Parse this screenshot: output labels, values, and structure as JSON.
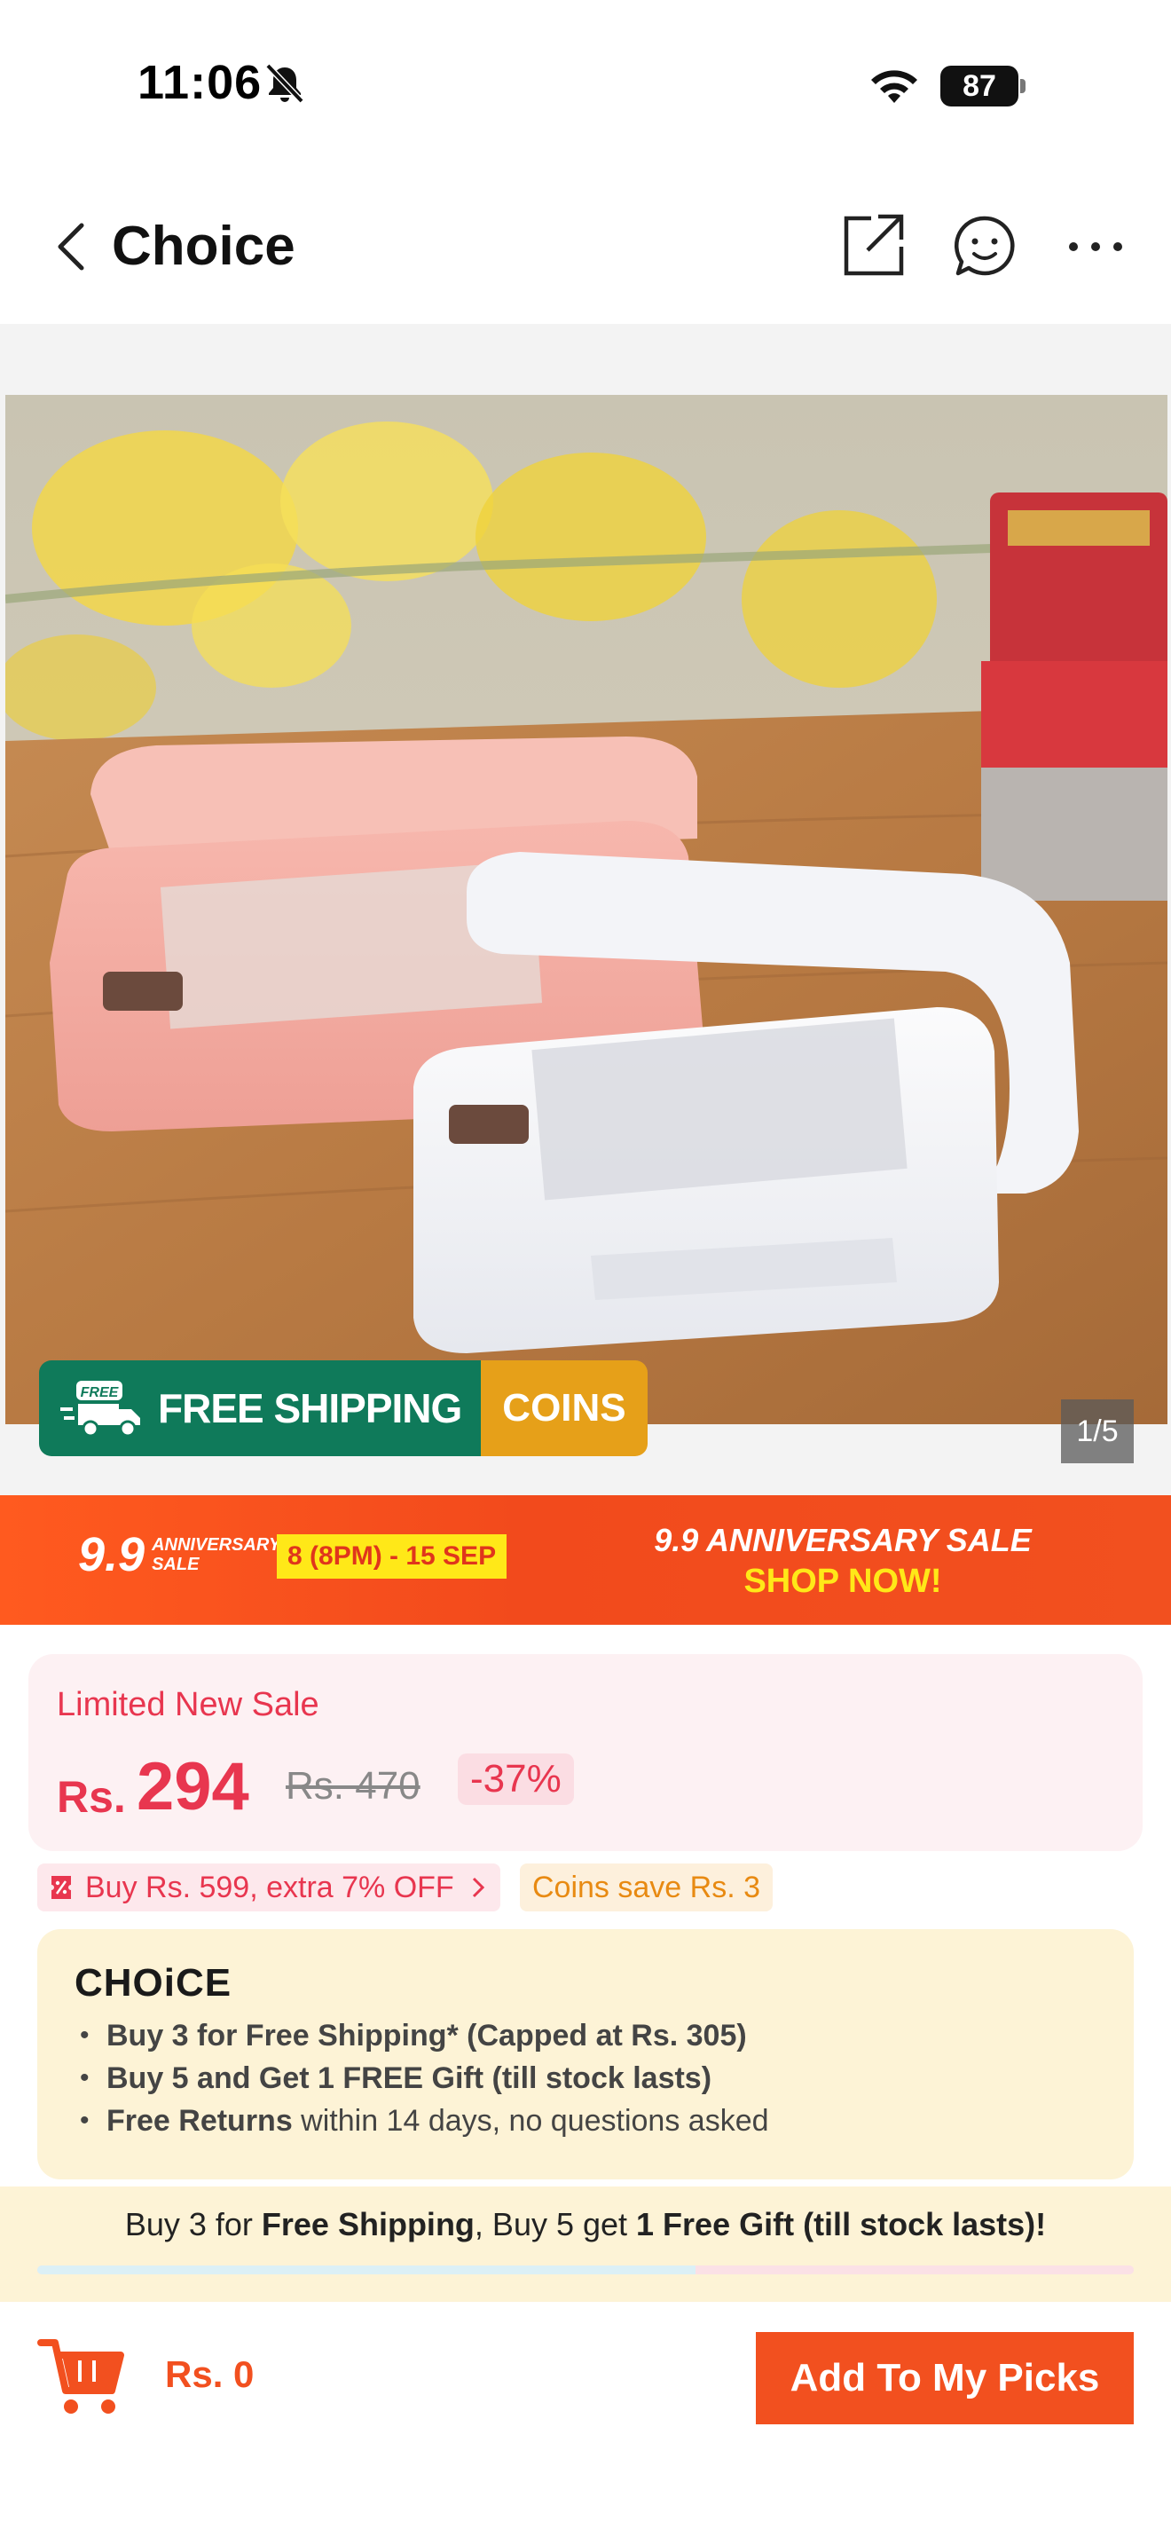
{
  "status_bar": {
    "time": "11:06",
    "battery": "87",
    "icons": [
      "bell-slash-icon",
      "wifi-icon",
      "battery-icon"
    ]
  },
  "nav": {
    "title": "Choice",
    "icons": [
      "back-chevron-icon",
      "share-icon",
      "chat-icon",
      "more-icon"
    ]
  },
  "gallery": {
    "image_alt": "Pink and white handheld mini bag sealers on a wooden table",
    "badge_shipping": "FREE SHIPPING",
    "badge_free_tag": "FREE",
    "badge_coins": "COINS",
    "pager": "1/5"
  },
  "promo": {
    "logo_number": "9.9",
    "logo_text_line1": "ANNIVERSARY",
    "logo_text_line2": "SALE",
    "date": "8 (8PM) - 15 SEP",
    "headline": "9.9 ANNIVERSARY SALE",
    "cta": "SHOP NOW!"
  },
  "price": {
    "label": "Limited New Sale",
    "currency": "Rs.",
    "current": "294",
    "original": "Rs. 470",
    "discount": "-37%"
  },
  "offers": {
    "coupon": "Buy Rs. 599, extra 7% OFF",
    "coins": "Coins save Rs. 3"
  },
  "choice": {
    "logo": "CHOiCE",
    "items": [
      {
        "bold": "Buy 3 for  Free Shipping* (Capped at Rs. 305)",
        "rest": ""
      },
      {
        "bold": "Buy 5 and Get 1 FREE Gift (till stock lasts)",
        "rest": ""
      },
      {
        "bold": "Free Returns",
        "rest": " within 14 days, no questions asked"
      }
    ]
  },
  "strip": {
    "part1": "Buy 3 for ",
    "part2": "Free Shipping",
    "part3": ", Buy 5 get ",
    "part4": "1 Free Gift (till stock lasts)!",
    "progress_fraction": 0.6
  },
  "bottom": {
    "cart_total": "Rs. 0",
    "button": "Add To My Picks"
  },
  "colors": {
    "accent": "#f2501f",
    "price_red": "#e8364f",
    "shipping_green": "#0f7a5a",
    "coins_orange": "#e6a019",
    "choice_bg": "#fdf3d6"
  }
}
